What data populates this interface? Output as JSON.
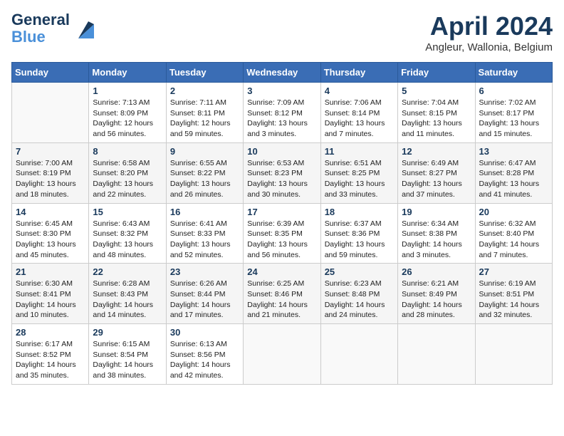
{
  "logo": {
    "line1": "General",
    "line2": "Blue"
  },
  "title": "April 2024",
  "subtitle": "Angleur, Wallonia, Belgium",
  "days_header": [
    "Sunday",
    "Monday",
    "Tuesday",
    "Wednesday",
    "Thursday",
    "Friday",
    "Saturday"
  ],
  "weeks": [
    [
      {
        "num": "",
        "lines": []
      },
      {
        "num": "1",
        "lines": [
          "Sunrise: 7:13 AM",
          "Sunset: 8:09 PM",
          "Daylight: 12 hours",
          "and 56 minutes."
        ]
      },
      {
        "num": "2",
        "lines": [
          "Sunrise: 7:11 AM",
          "Sunset: 8:11 PM",
          "Daylight: 12 hours",
          "and 59 minutes."
        ]
      },
      {
        "num": "3",
        "lines": [
          "Sunrise: 7:09 AM",
          "Sunset: 8:12 PM",
          "Daylight: 13 hours",
          "and 3 minutes."
        ]
      },
      {
        "num": "4",
        "lines": [
          "Sunrise: 7:06 AM",
          "Sunset: 8:14 PM",
          "Daylight: 13 hours",
          "and 7 minutes."
        ]
      },
      {
        "num": "5",
        "lines": [
          "Sunrise: 7:04 AM",
          "Sunset: 8:15 PM",
          "Daylight: 13 hours",
          "and 11 minutes."
        ]
      },
      {
        "num": "6",
        "lines": [
          "Sunrise: 7:02 AM",
          "Sunset: 8:17 PM",
          "Daylight: 13 hours",
          "and 15 minutes."
        ]
      }
    ],
    [
      {
        "num": "7",
        "lines": [
          "Sunrise: 7:00 AM",
          "Sunset: 8:19 PM",
          "Daylight: 13 hours",
          "and 18 minutes."
        ]
      },
      {
        "num": "8",
        "lines": [
          "Sunrise: 6:58 AM",
          "Sunset: 8:20 PM",
          "Daylight: 13 hours",
          "and 22 minutes."
        ]
      },
      {
        "num": "9",
        "lines": [
          "Sunrise: 6:55 AM",
          "Sunset: 8:22 PM",
          "Daylight: 13 hours",
          "and 26 minutes."
        ]
      },
      {
        "num": "10",
        "lines": [
          "Sunrise: 6:53 AM",
          "Sunset: 8:23 PM",
          "Daylight: 13 hours",
          "and 30 minutes."
        ]
      },
      {
        "num": "11",
        "lines": [
          "Sunrise: 6:51 AM",
          "Sunset: 8:25 PM",
          "Daylight: 13 hours",
          "and 33 minutes."
        ]
      },
      {
        "num": "12",
        "lines": [
          "Sunrise: 6:49 AM",
          "Sunset: 8:27 PM",
          "Daylight: 13 hours",
          "and 37 minutes."
        ]
      },
      {
        "num": "13",
        "lines": [
          "Sunrise: 6:47 AM",
          "Sunset: 8:28 PM",
          "Daylight: 13 hours",
          "and 41 minutes."
        ]
      }
    ],
    [
      {
        "num": "14",
        "lines": [
          "Sunrise: 6:45 AM",
          "Sunset: 8:30 PM",
          "Daylight: 13 hours",
          "and 45 minutes."
        ]
      },
      {
        "num": "15",
        "lines": [
          "Sunrise: 6:43 AM",
          "Sunset: 8:32 PM",
          "Daylight: 13 hours",
          "and 48 minutes."
        ]
      },
      {
        "num": "16",
        "lines": [
          "Sunrise: 6:41 AM",
          "Sunset: 8:33 PM",
          "Daylight: 13 hours",
          "and 52 minutes."
        ]
      },
      {
        "num": "17",
        "lines": [
          "Sunrise: 6:39 AM",
          "Sunset: 8:35 PM",
          "Daylight: 13 hours",
          "and 56 minutes."
        ]
      },
      {
        "num": "18",
        "lines": [
          "Sunrise: 6:37 AM",
          "Sunset: 8:36 PM",
          "Daylight: 13 hours",
          "and 59 minutes."
        ]
      },
      {
        "num": "19",
        "lines": [
          "Sunrise: 6:34 AM",
          "Sunset: 8:38 PM",
          "Daylight: 14 hours",
          "and 3 minutes."
        ]
      },
      {
        "num": "20",
        "lines": [
          "Sunrise: 6:32 AM",
          "Sunset: 8:40 PM",
          "Daylight: 14 hours",
          "and 7 minutes."
        ]
      }
    ],
    [
      {
        "num": "21",
        "lines": [
          "Sunrise: 6:30 AM",
          "Sunset: 8:41 PM",
          "Daylight: 14 hours",
          "and 10 minutes."
        ]
      },
      {
        "num": "22",
        "lines": [
          "Sunrise: 6:28 AM",
          "Sunset: 8:43 PM",
          "Daylight: 14 hours",
          "and 14 minutes."
        ]
      },
      {
        "num": "23",
        "lines": [
          "Sunrise: 6:26 AM",
          "Sunset: 8:44 PM",
          "Daylight: 14 hours",
          "and 17 minutes."
        ]
      },
      {
        "num": "24",
        "lines": [
          "Sunrise: 6:25 AM",
          "Sunset: 8:46 PM",
          "Daylight: 14 hours",
          "and 21 minutes."
        ]
      },
      {
        "num": "25",
        "lines": [
          "Sunrise: 6:23 AM",
          "Sunset: 8:48 PM",
          "Daylight: 14 hours",
          "and 24 minutes."
        ]
      },
      {
        "num": "26",
        "lines": [
          "Sunrise: 6:21 AM",
          "Sunset: 8:49 PM",
          "Daylight: 14 hours",
          "and 28 minutes."
        ]
      },
      {
        "num": "27",
        "lines": [
          "Sunrise: 6:19 AM",
          "Sunset: 8:51 PM",
          "Daylight: 14 hours",
          "and 32 minutes."
        ]
      }
    ],
    [
      {
        "num": "28",
        "lines": [
          "Sunrise: 6:17 AM",
          "Sunset: 8:52 PM",
          "Daylight: 14 hours",
          "and 35 minutes."
        ]
      },
      {
        "num": "29",
        "lines": [
          "Sunrise: 6:15 AM",
          "Sunset: 8:54 PM",
          "Daylight: 14 hours",
          "and 38 minutes."
        ]
      },
      {
        "num": "30",
        "lines": [
          "Sunrise: 6:13 AM",
          "Sunset: 8:56 PM",
          "Daylight: 14 hours",
          "and 42 minutes."
        ]
      },
      {
        "num": "",
        "lines": []
      },
      {
        "num": "",
        "lines": []
      },
      {
        "num": "",
        "lines": []
      },
      {
        "num": "",
        "lines": []
      }
    ]
  ]
}
